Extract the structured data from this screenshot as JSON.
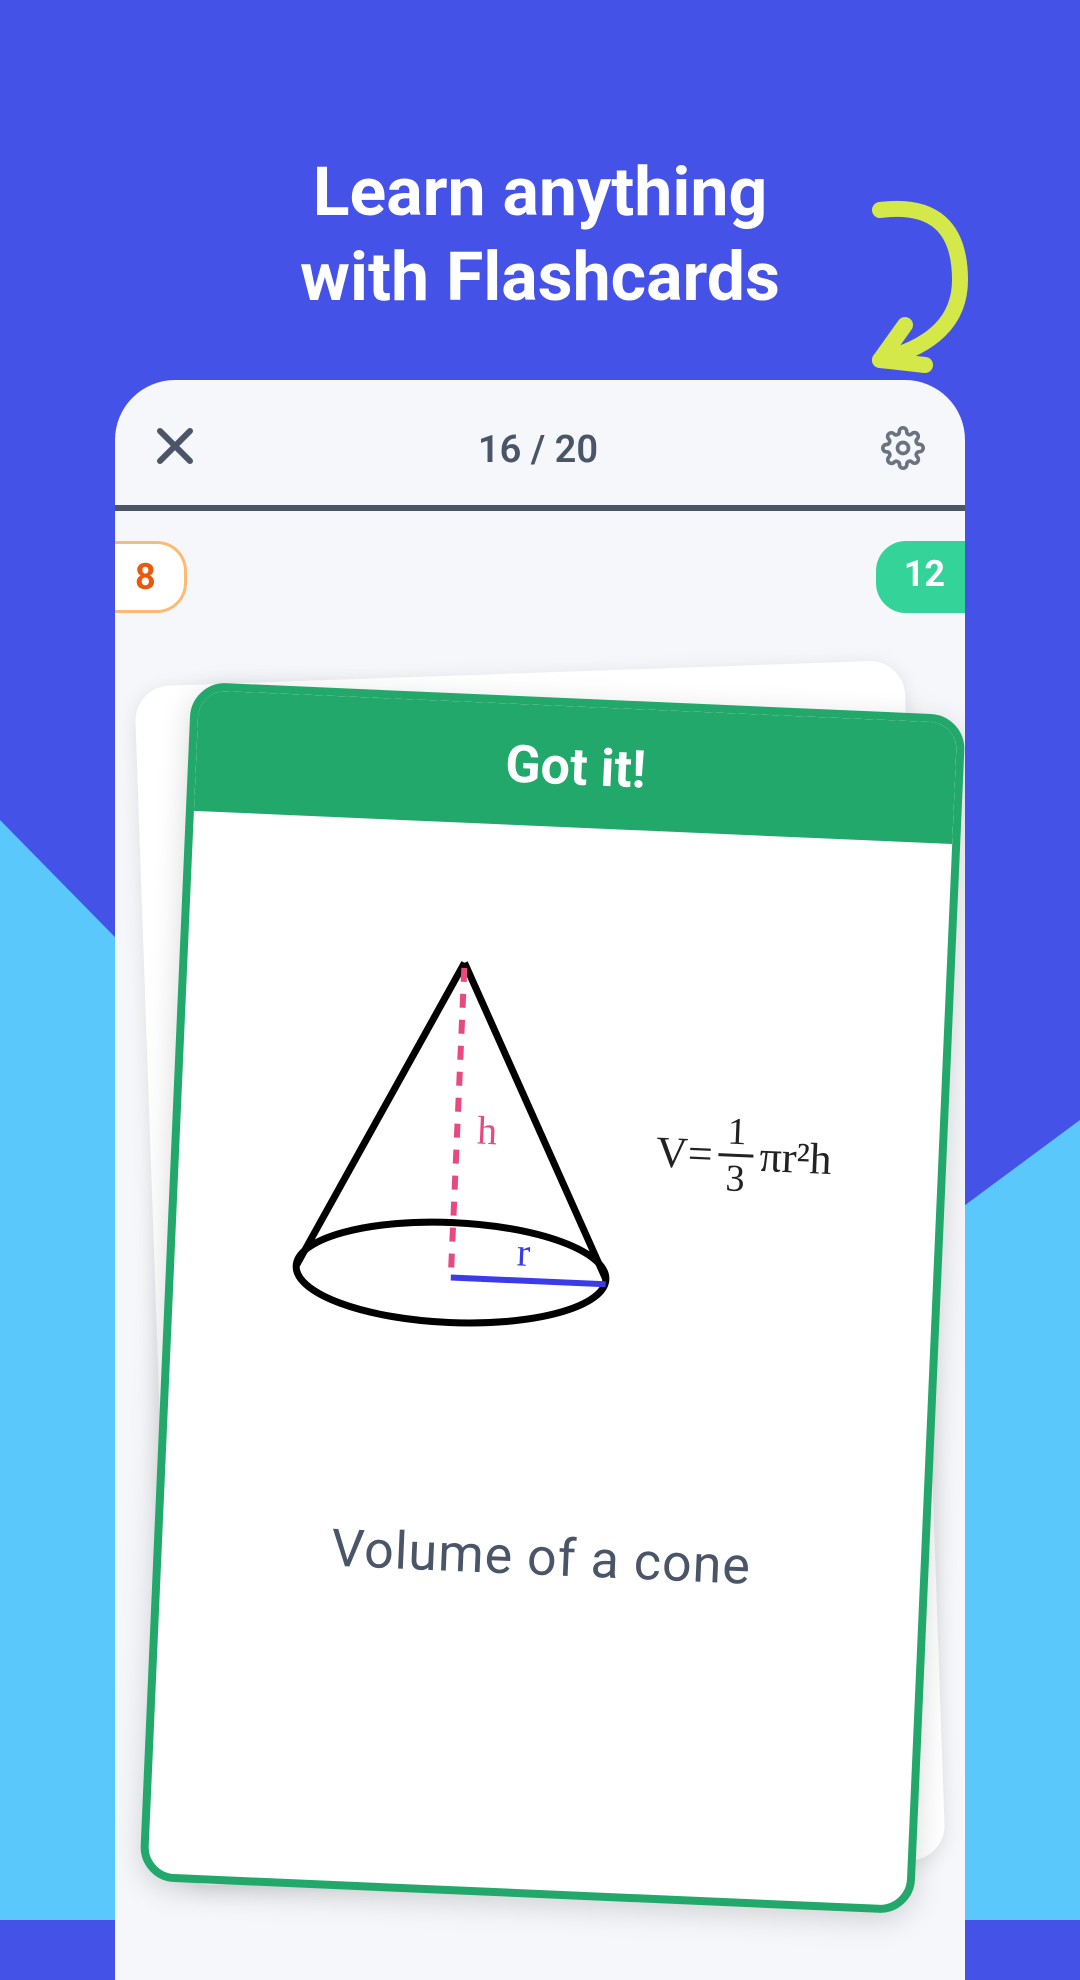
{
  "headline": {
    "line1": "Learn anything",
    "line2": "with Flashcards"
  },
  "phone": {
    "progress_label": "16 / 20",
    "score_left": "8",
    "score_right": "12"
  },
  "card": {
    "banner": "Got it!",
    "formula_prefix": "V=",
    "formula_num": "1",
    "formula_den": "3",
    "formula_suffix": "πr²h",
    "diagram_h": "h",
    "diagram_r": "r",
    "caption": "Volume of a cone"
  }
}
